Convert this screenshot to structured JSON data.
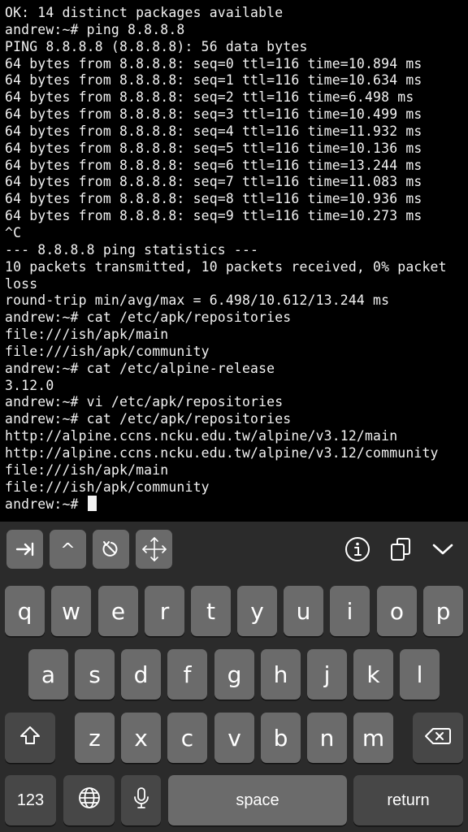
{
  "terminal": {
    "lines": [
      "OK: 14 distinct packages available",
      "andrew:~# ping 8.8.8.8",
      "PING 8.8.8.8 (8.8.8.8): 56 data bytes",
      "64 bytes from 8.8.8.8: seq=0 ttl=116 time=10.894 ms",
      "64 bytes from 8.8.8.8: seq=1 ttl=116 time=10.634 ms",
      "64 bytes from 8.8.8.8: seq=2 ttl=116 time=6.498 ms",
      "64 bytes from 8.8.8.8: seq=3 ttl=116 time=10.499 ms",
      "64 bytes from 8.8.8.8: seq=4 ttl=116 time=11.932 ms",
      "64 bytes from 8.8.8.8: seq=5 ttl=116 time=10.136 ms",
      "64 bytes from 8.8.8.8: seq=6 ttl=116 time=13.244 ms",
      "64 bytes from 8.8.8.8: seq=7 ttl=116 time=11.083 ms",
      "64 bytes from 8.8.8.8: seq=8 ttl=116 time=10.936 ms",
      "64 bytes from 8.8.8.8: seq=9 ttl=116 time=10.273 ms",
      "^C",
      "--- 8.8.8.8 ping statistics ---",
      "10 packets transmitted, 10 packets received, 0% packet",
      "loss",
      "round-trip min/avg/max = 6.498/10.612/13.244 ms",
      "andrew:~# cat /etc/apk/repositories",
      "file:///ish/apk/main",
      "file:///ish/apk/community",
      "andrew:~# cat /etc/alpine-release",
      "3.12.0",
      "andrew:~# vi /etc/apk/repositories",
      "andrew:~# cat /etc/apk/repositories",
      "http://alpine.ccns.ncku.edu.tw/alpine/v3.12/main",
      "http://alpine.ccns.ncku.edu.tw/alpine/v3.12/community",
      "file:///ish/apk/main",
      "file:///ish/apk/community"
    ],
    "prompt": "andrew:~# ",
    "colors": {
      "background": "#000000",
      "foreground": "#f2f2f2"
    }
  },
  "accessory_bar": {
    "buttons": [
      {
        "name": "tab-key-button",
        "icon": "tab-arrow-icon"
      },
      {
        "name": "control-key-button",
        "icon": "caret-icon",
        "label": "^"
      },
      {
        "name": "escape-key-button",
        "icon": "escape-icon"
      },
      {
        "name": "arrow-keys-button",
        "icon": "move-arrows-icon"
      }
    ],
    "right_icons": [
      "info-icon",
      "paste-icon",
      "hide-keyboard-chevron-icon"
    ]
  },
  "keyboard": {
    "row1": [
      "q",
      "w",
      "e",
      "r",
      "t",
      "y",
      "u",
      "i",
      "o",
      "p"
    ],
    "row2": [
      "a",
      "s",
      "d",
      "f",
      "g",
      "h",
      "j",
      "k",
      "l"
    ],
    "row3": [
      "z",
      "x",
      "c",
      "v",
      "b",
      "n",
      "m"
    ],
    "numbers_label": "123",
    "space_label": "space",
    "return_label": "return",
    "colors": {
      "key": "#6b6b6b",
      "dark_key": "#474747",
      "background": "#2b2b2b"
    }
  }
}
